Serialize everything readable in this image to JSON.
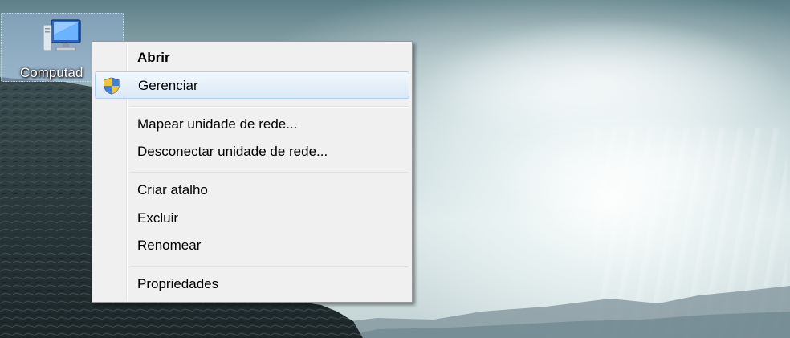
{
  "desktop": {
    "icon": {
      "label": "Computad",
      "icon": "computer-icon"
    }
  },
  "context_menu": {
    "items": [
      {
        "label": "Abrir",
        "bold": true
      },
      {
        "label": "Gerenciar",
        "icon": "uac-shield-icon",
        "highlighted": true
      },
      {
        "label": "Mapear unidade de rede..."
      },
      {
        "label": "Desconectar unidade de rede..."
      },
      {
        "label": "Criar atalho"
      },
      {
        "label": "Excluir"
      },
      {
        "label": "Renomear"
      },
      {
        "label": "Propriedades"
      }
    ]
  },
  "colors": {
    "menu_background": "#f0f0f0",
    "menu_border": "#979797",
    "highlight_border": "#aecff7",
    "highlight_fill": "#e6f0fa"
  }
}
